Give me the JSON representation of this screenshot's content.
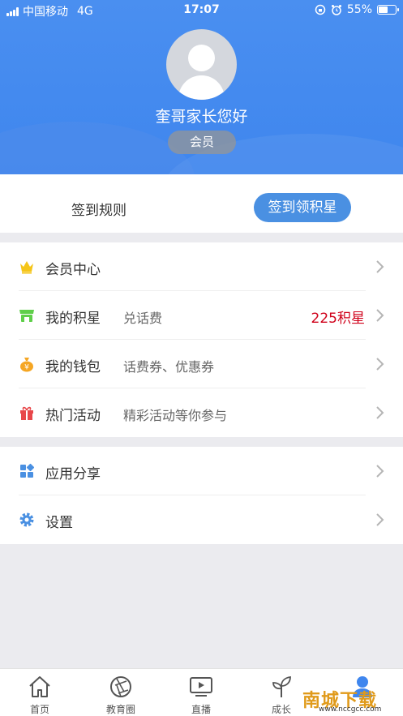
{
  "status_bar": {
    "carrier": "中国移动",
    "network": "4G",
    "time": "17:07",
    "battery": "55%",
    "battery_level": 0.55
  },
  "profile": {
    "greeting": "奎哥家长您好",
    "badge": "会员"
  },
  "checkin": {
    "rules_label": "签到规则",
    "button_label": "签到领积星"
  },
  "menu_group_1": [
    {
      "icon": "crown-icon",
      "title": "会员中心",
      "subtitle": "",
      "value": ""
    },
    {
      "icon": "shop-icon",
      "title": "我的积星",
      "subtitle": "兑话费",
      "value": "225积星"
    },
    {
      "icon": "money-bag-icon",
      "title": "我的钱包",
      "subtitle": "话费券、优惠券",
      "value": ""
    },
    {
      "icon": "gift-icon",
      "title": "热门活动",
      "subtitle": "精彩活动等你参与",
      "value": ""
    }
  ],
  "menu_group_2": [
    {
      "icon": "apps-icon",
      "title": "应用分享"
    },
    {
      "icon": "gear-icon",
      "title": "设置"
    }
  ],
  "tabbar": [
    {
      "icon": "home-icon",
      "label": "首页"
    },
    {
      "icon": "aperture-icon",
      "label": "教育圈"
    },
    {
      "icon": "play-screen-icon",
      "label": "直播"
    },
    {
      "icon": "sprout-icon",
      "label": "成长"
    },
    {
      "icon": "person-icon",
      "label": ""
    }
  ],
  "watermark": {
    "text": "南城下载",
    "url": "www.nccgcc.com"
  },
  "colors": {
    "header_blue": "#3f86ee",
    "button_blue": "#4a90e2",
    "value_red": "#d0021b",
    "background": "#ebebef"
  }
}
